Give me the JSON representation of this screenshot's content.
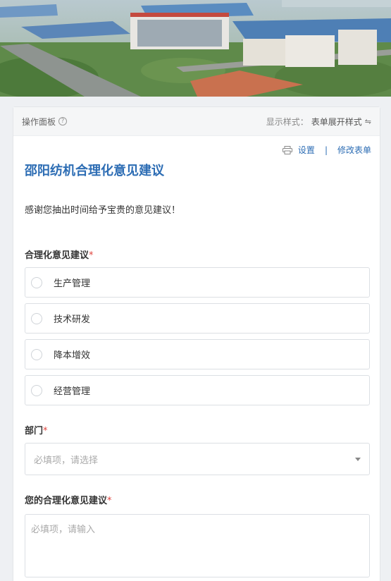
{
  "panel": {
    "title": "操作面板",
    "help_icon": "?",
    "display_label": "显示样式：",
    "display_value": "表单展开样式",
    "swap_icon": "⇋"
  },
  "toolbar": {
    "settings": "设置",
    "separator": "|",
    "edit": "修改表单"
  },
  "form": {
    "title": "邵阳纺机合理化意见建议",
    "description": "感谢您抽出时间给予宝贵的意见建议！",
    "q1": {
      "label": "合理化意见建议",
      "required": "*",
      "options": [
        "生产管理",
        "技术研发",
        "降本增效",
        "经营管理"
      ]
    },
    "q2": {
      "label": "部门",
      "required": "*",
      "placeholder": "必填项，请选择"
    },
    "q3": {
      "label": "您的合理化意见建议",
      "required": "*",
      "placeholder": "必填项，请输入"
    }
  }
}
